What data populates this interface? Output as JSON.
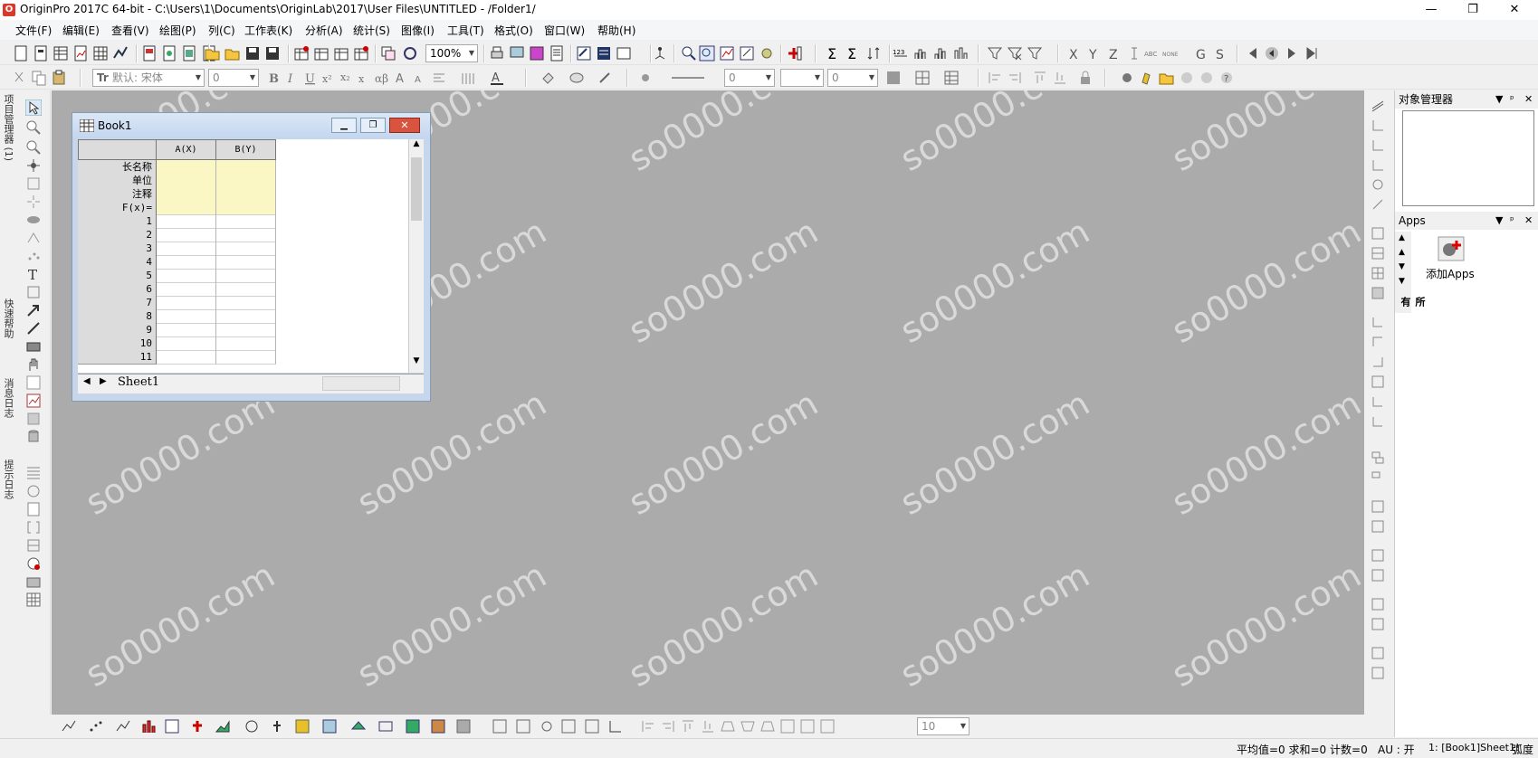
{
  "window": {
    "title": "OriginPro 2017C 64-bit - C:\\Users\\1\\Documents\\OriginLab\\2017\\User Files\\UNTITLED - /Folder1/",
    "minimize": "—",
    "maximize": "❐",
    "close": "✕"
  },
  "menu": [
    "文件(F)",
    "编辑(E)",
    "查看(V)",
    "绘图(P)",
    "列(C)",
    "工作表(K)",
    "分析(A)",
    "统计(S)",
    "图像(I)",
    "工具(T)",
    "格式(O)",
    "窗口(W)",
    "帮助(H)"
  ],
  "toolbar1": {
    "zoom": "100%"
  },
  "toolbar2": {
    "font": "默认: 宋体",
    "font_size": "0",
    "line_width": "0",
    "size2": "0"
  },
  "left_tabs": [
    "项目管理器 (1)",
    "快速帮助",
    "消息日志",
    "提示日志"
  ],
  "workbook": {
    "title": "Book1",
    "columns": [
      "A(X)",
      "B(Y)"
    ],
    "meta_rows": [
      "长名称",
      "单位",
      "注释",
      "F(x)="
    ],
    "rows": [
      "1",
      "2",
      "3",
      "4",
      "5",
      "6",
      "7",
      "8",
      "9",
      "10",
      "11"
    ],
    "sheet": "Sheet1"
  },
  "right_panel": {
    "object_manager": "对象管理器",
    "apps_title": "Apps",
    "add_apps": "添加Apps",
    "tab_all": "所有"
  },
  "bottom_toolbar": {
    "size": "10"
  },
  "status": {
    "stats": "平均值=0 求和=0 计数=0",
    "au": "AU : 开",
    "ref": "1: [Book1]Sheet1!",
    "angle": "弧度"
  },
  "watermark": "so0000.com"
}
